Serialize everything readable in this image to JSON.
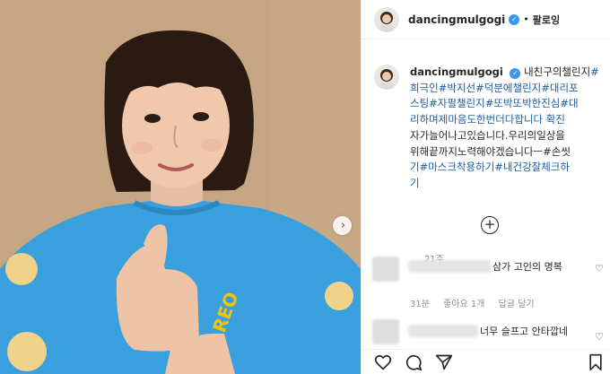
{
  "post": {
    "username": "dancingmulgogi",
    "follow_label": "팔로잉",
    "dot": "•"
  },
  "caption": {
    "username": "dancingmulgogi",
    "lines": [
      {
        "text": " 내친구의챌린지",
        "tag": "#"
      },
      {
        "text": "희극인#박지선#덕분에챌린지#대리포",
        "tag": ""
      },
      {
        "text": "스팅#자필챌린지#또박또박한진심#대",
        "tag": ""
      },
      {
        "text": "리하며제마음도한번더다합니다 확진",
        "tag": ""
      },
      {
        "text": "자가늘어나고있습니다.우리의일상을",
        "tag": ""
      },
      {
        "text": "위해끝까지노력해야겠습니다ㅡ#손씻",
        "tag": ""
      },
      {
        "text": "기#마스크착용하기#내건강잘체크하",
        "tag": ""
      },
      {
        "text": "기",
        "tag": ""
      }
    ],
    "time": "21주"
  },
  "comments": [
    {
      "text": "삼가 고인의 명복",
      "time": "31분",
      "likes": "좋아요 1개",
      "reply": "답글 달기"
    },
    {
      "text": "너무 슬프고 안타깝네"
    }
  ],
  "icons": {
    "next": "chevron-right-icon",
    "load_more": "plus-circle-icon",
    "like": "heart-icon",
    "comment": "comment-icon",
    "share": "paper-plane-icon",
    "save": "bookmark-icon",
    "verified": "verified-badge-icon"
  },
  "colors": {
    "hashtag": "#1e5b99",
    "verified": "#3897f0",
    "muted": "#8e8e8e",
    "sweater": "#3aa0dd",
    "wall": "#c8a984"
  }
}
